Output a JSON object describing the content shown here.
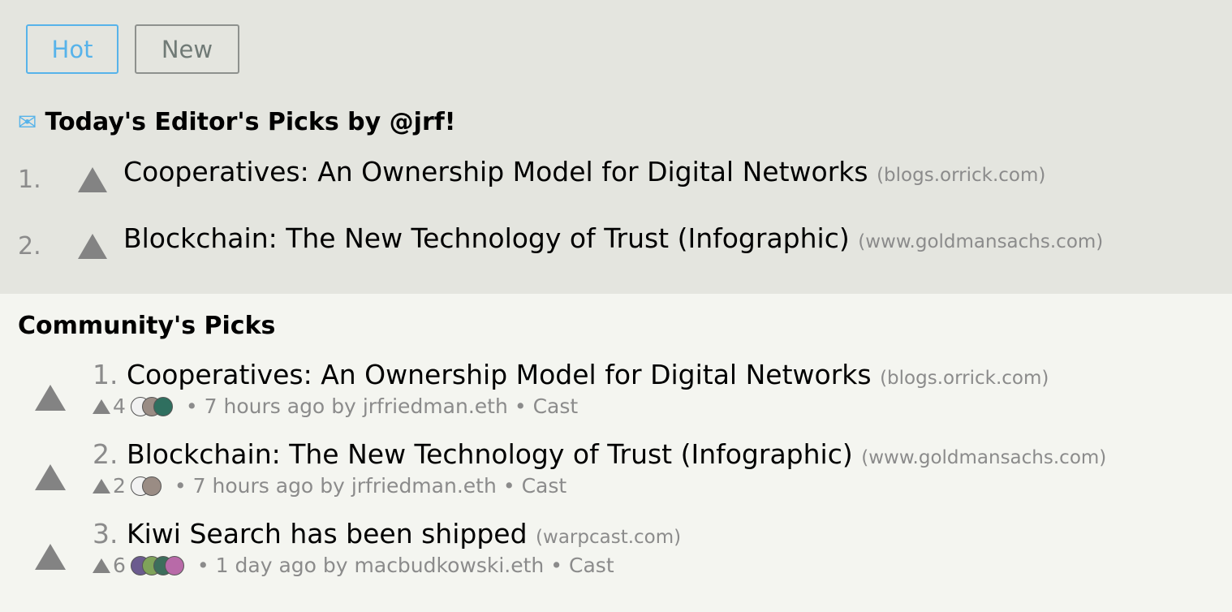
{
  "tabs": {
    "hot": "Hot",
    "new": "New"
  },
  "editor": {
    "envelope_icon": "✉",
    "header": "Today's Editor's Picks by @jrf!",
    "items": [
      {
        "num": "1.",
        "title": "Cooperatives: An Ownership Model for Digital Networks",
        "domain": "(blogs.orrick.com)"
      },
      {
        "num": "2.",
        "title": "Blockchain: The New Technology of Trust (Infographic)",
        "domain": "(www.goldmansachs.com)"
      }
    ]
  },
  "community": {
    "header": "Community's Picks",
    "items": [
      {
        "num": "1.",
        "title": "Cooperatives: An Ownership Model for Digital Networks",
        "domain": "(blogs.orrick.com)",
        "votes": "4",
        "time": "7 hours ago",
        "by": "by",
        "author": "jrfriedman.eth",
        "source": "Cast",
        "avatars": [
          "#f2f2f2",
          "#9a8c84",
          "#2f6f5f"
        ]
      },
      {
        "num": "2.",
        "title": "Blockchain: The New Technology of Trust (Infographic)",
        "domain": "(www.goldmansachs.com)",
        "votes": "2",
        "time": "7 hours ago",
        "by": "by",
        "author": "jrfriedman.eth",
        "source": "Cast",
        "avatars": [
          "#f2f2f2",
          "#9a8c84"
        ]
      },
      {
        "num": "3.",
        "title": "Kiwi Search has been shipped",
        "domain": "(warpcast.com)",
        "votes": "6",
        "time": "1 day ago",
        "by": "by",
        "author": "macbudkowski.eth",
        "source": "Cast",
        "avatars": [
          "#6b5b8f",
          "#7fa35a",
          "#3d6e5c",
          "#b86aa8"
        ]
      }
    ]
  },
  "colors": {
    "accent": "#57b3ea",
    "top_bg": "#e4e5df",
    "page_bg": "#f4f5f0",
    "muted": "#8b8b8b"
  }
}
